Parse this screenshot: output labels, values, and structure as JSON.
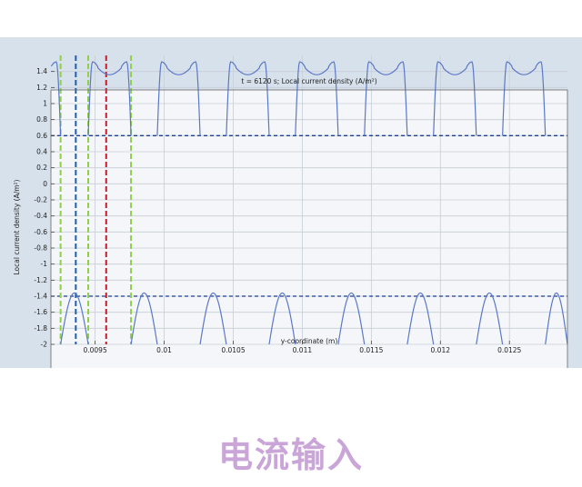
{
  "caption": "电流输入",
  "chart_data": {
    "type": "line",
    "title": "t = 6120 s;   Local current density (A/m²)",
    "xlabel": "y-coordinate (m)",
    "ylabel": "Local current density (A/m²)",
    "xlim": [
      0.00918,
      0.01292
    ],
    "ylim": [
      -2,
      1.6
    ],
    "x_ticks": [
      0.0095,
      0.01,
      0.0105,
      0.011,
      0.0115,
      0.012,
      0.0125
    ],
    "x_tick_labels": [
      "0.0095",
      "0.01",
      "0.0105",
      "0.011",
      "0.0115",
      "0.012",
      "0.0125"
    ],
    "y_ticks": [
      -2,
      -1.8,
      -1.6,
      -1.4,
      -1.2,
      -1,
      -0.8,
      -0.6,
      -0.4,
      -0.2,
      0,
      0.2,
      0.4,
      0.6,
      0.8,
      1,
      1.2,
      1.4
    ],
    "y_tick_labels": [
      "-2",
      "-1.8",
      "-1.6",
      "-1.4",
      "-1.2",
      "-1",
      "-0.8",
      "-0.6",
      "-0.4",
      "-0.2",
      "0",
      "0.2",
      "0.4",
      "0.6",
      "0.8",
      "1",
      "1.2",
      "1.4"
    ],
    "grid": true,
    "upper_series": {
      "color": "#5b78c8",
      "baseline": 0.6,
      "shoulder": 1.52,
      "dip": 1.36,
      "segments": [
        [
          0.00918,
          0.00925
        ],
        [
          0.00945,
          0.00976
        ],
        [
          0.00995,
          0.01026
        ],
        [
          0.01045,
          0.01076
        ],
        [
          0.01095,
          0.01126
        ],
        [
          0.01145,
          0.01176
        ],
        [
          0.01195,
          0.01226
        ],
        [
          0.01245,
          0.01276
        ]
      ]
    },
    "lower_series": {
      "color": "#5b78c8",
      "baseline": -2,
      "peak": -1.36,
      "segments": [
        [
          0.00925,
          0.00945
        ],
        [
          0.00976,
          0.00995
        ],
        [
          0.01026,
          0.01045
        ],
        [
          0.01076,
          0.01095
        ],
        [
          0.01126,
          0.01145
        ],
        [
          0.01176,
          0.01195
        ],
        [
          0.01226,
          0.01245
        ],
        [
          0.01276,
          0.01292
        ]
      ]
    },
    "reference_lines": {
      "horizontal": [
        {
          "y": 0.6,
          "color": "#1f3f8f"
        },
        {
          "y": -1.4,
          "color": "#1f3f8f"
        }
      ],
      "vertical": [
        {
          "x": 0.00925,
          "color": "#8ed04a"
        },
        {
          "x": 0.00936,
          "color": "#1f5fb0"
        },
        {
          "x": 0.00945,
          "color": "#8ed04a"
        },
        {
          "x": 0.00958,
          "color": "#c21f2a"
        },
        {
          "x": 0.00976,
          "color": "#8ed04a"
        }
      ]
    }
  }
}
